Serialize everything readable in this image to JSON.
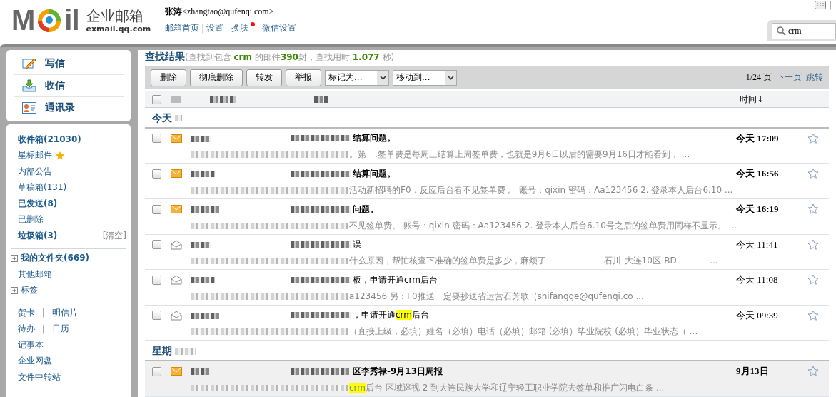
{
  "logo": {
    "left": "M",
    "right": "il",
    "product": "企业邮箱",
    "domain": "exmail.qq.com"
  },
  "user": {
    "name": "张涛",
    "email": "<zhangtao@qufenqi.com>"
  },
  "nav": [
    {
      "kind": "link",
      "text": "邮箱首页",
      "dot": false
    },
    {
      "kind": "sep",
      "text": "|"
    },
    {
      "kind": "link",
      "text": "设置",
      "dot": false
    },
    {
      "kind": "sep",
      "text": "-"
    },
    {
      "kind": "link",
      "text": "换肤",
      "dot": true
    },
    {
      "kind": "sep",
      "text": "|"
    },
    {
      "kind": "link",
      "text": "微信设置",
      "dot": false
    }
  ],
  "top_right": {
    "separator": "|"
  },
  "search": {
    "value": "crm"
  },
  "sidebar": {
    "actions": [
      {
        "kind": "write",
        "label": "写信"
      },
      {
        "kind": "inbox",
        "label": "收信"
      },
      {
        "kind": "contacts",
        "label": "通讯录"
      }
    ],
    "sections": [
      [
        {
          "kind": "folder",
          "label": "收件箱(21030)",
          "bold": true
        },
        {
          "kind": "starred",
          "label": "星标邮件",
          "bold": false
        },
        {
          "kind": "folder",
          "label": "内部公告",
          "bold": false
        },
        {
          "kind": "folder",
          "label": "草稿箱(131)",
          "bold": false
        },
        {
          "kind": "folder",
          "label": "已发送(8)",
          "bold": true
        },
        {
          "kind": "folder",
          "label": "已删除",
          "bold": false
        },
        {
          "kind": "folder",
          "label": "垃圾箱(3)",
          "bold": true,
          "action": "[清空]"
        }
      ],
      [
        {
          "kind": "tree",
          "label": "我的文件夹(669)",
          "bold": true,
          "expanded": false
        },
        {
          "kind": "folder",
          "label": "其他邮箱",
          "bold": false
        },
        {
          "kind": "tree",
          "label": "标签",
          "bold": false,
          "expanded": false
        }
      ],
      [
        {
          "kind": "pair",
          "links": [
            "贺卡",
            "明信片"
          ],
          "separator": "|"
        },
        {
          "kind": "pair",
          "links": [
            "待办",
            "日历"
          ],
          "separator": "|"
        },
        {
          "kind": "folder",
          "label": "记事本",
          "bold": false
        },
        {
          "kind": "folder",
          "label": "企业网盘",
          "bold": false
        },
        {
          "kind": "folder",
          "label": "文件中转站",
          "bold": false
        }
      ]
    ]
  },
  "results": {
    "title": "查找结果",
    "summary": "(查找到包含 **crm** 的邮件**390**封，查找用时 **1.077** 秒)"
  },
  "toolbar": {
    "buttons": [
      "删除",
      "彻底删除",
      "转发",
      "举报"
    ],
    "selects": [
      "标记为...",
      "移动到..."
    ],
    "page": "1/24 页",
    "links": [
      "下一页",
      "跳转"
    ]
  },
  "columns": {
    "checked": false,
    "time": "时间↓"
  },
  "groups": [
    {
      "label": "今天",
      "rows": [
        {
          "unread": true,
          "selected": false,
          "checked": false,
          "starred": false,
          "subject": [
            {
              "text": "结算问题。",
              "hit": false
            }
          ],
          "preview": [
            {
              "text": "。第一,签单费是每周三结算上周签单费，也就是9月6日以后的需要9月16日才能看到， ...",
              "hit": false
            }
          ],
          "time": "今天 17:09"
        },
        {
          "unread": true,
          "selected": false,
          "checked": false,
          "starred": false,
          "subject": [
            {
              "text": "结算问题。",
              "hit": false
            }
          ],
          "preview": [
            {
              "text": "活动新招聘的F0，反应后台看不见签单费 。 账号：qixin 密码：Aa123456 2. 登录本人后台6.10 ...",
              "hit": false
            }
          ],
          "time": "今天 16:56"
        },
        {
          "unread": true,
          "selected": false,
          "checked": false,
          "starred": false,
          "subject": [
            {
              "text": "问题。",
              "hit": false
            }
          ],
          "preview": [
            {
              "text": "不见签单费。 账号：qixin 密码：Aa123456 2. 登录本人后台6.10号之后的签单费用同样不显示。 ...",
              "hit": false
            }
          ],
          "time": "今天 16:19"
        },
        {
          "unread": false,
          "selected": false,
          "checked": false,
          "starred": false,
          "subject": [
            {
              "text": "误",
              "hit": false
            }
          ],
          "preview": [
            {
              "text": "什么原因，帮忙核查下准确的签单费是多少，麻烦了 ----------------- 石川-大连10区-BD --------- ...",
              "hit": false
            }
          ],
          "time": "今天 11:41"
        },
        {
          "unread": false,
          "selected": false,
          "checked": false,
          "starred": false,
          "subject": [
            {
              "text": "板，申请开通crm后台",
              "hit": false
            }
          ],
          "preview": [
            {
              "text": "a123456 另：F0推送一定要抄送省运营石芳歌（shifangge@qufenqi.co ...",
              "hit": false
            }
          ],
          "time": "今天 11:08"
        },
        {
          "unread": false,
          "selected": false,
          "checked": false,
          "starred": false,
          "subject": [
            {
              "text": "，申请开通",
              "hit": false
            },
            {
              "text": "crm",
              "hit": true
            },
            {
              "text": "后台",
              "hit": false
            }
          ],
          "preview": [
            {
              "text": "（直接上级，必填）姓名（必填）电话（必填）邮箱 (必填）毕业院校 (必填）毕业状态（ ...",
              "hit": false
            }
          ],
          "time": "今天 09:39"
        }
      ]
    },
    {
      "label": "星期",
      "rows": [
        {
          "unread": true,
          "selected": true,
          "checked": false,
          "starred": false,
          "subject": [
            {
              "text": "区李秀禄-9月13日周报",
              "hit": false
            }
          ],
          "preview": [
            {
              "text": "crm",
              "hit": true
            },
            {
              "text": "后台 区域巡视 2 到大连民族大学和辽宁轻工职业学院去签单和推广闪电白条 ...",
              "hit": false
            }
          ],
          "time": "9月13日"
        }
      ]
    }
  ]
}
